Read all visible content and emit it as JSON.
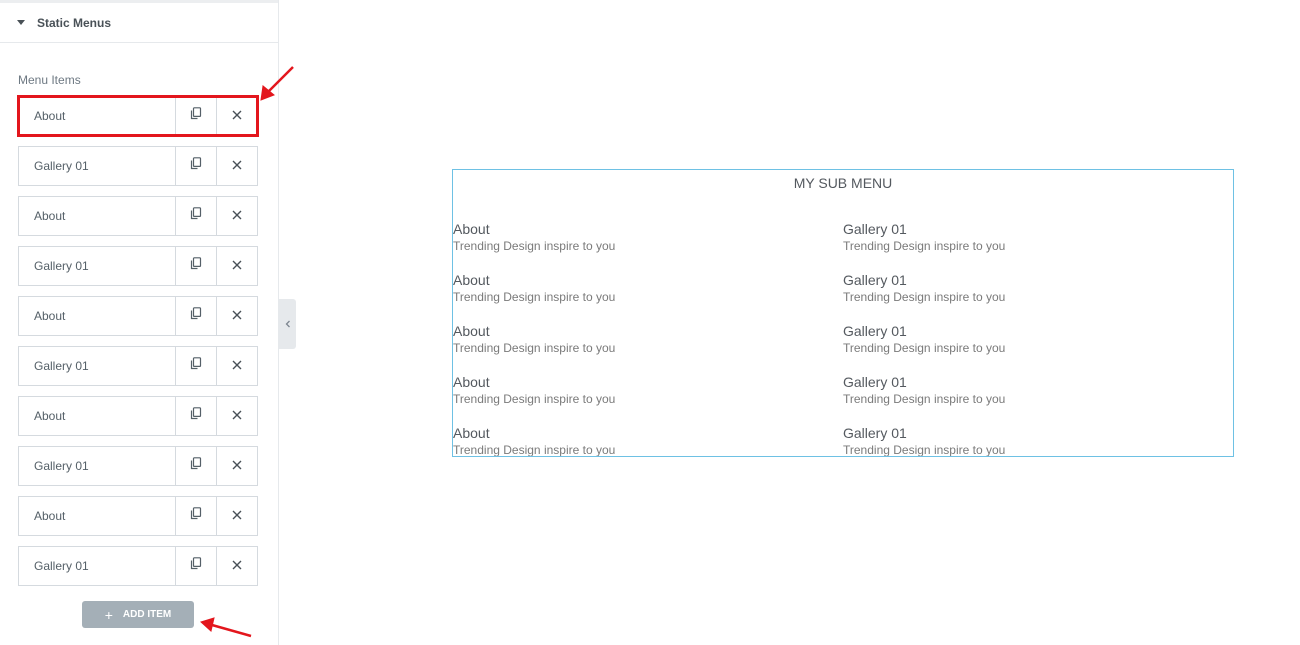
{
  "panel": {
    "section_title": "Static Menus",
    "items_label": "Menu Items",
    "items": [
      {
        "label": "About"
      },
      {
        "label": "Gallery 01"
      },
      {
        "label": "About"
      },
      {
        "label": "Gallery 01"
      },
      {
        "label": "About"
      },
      {
        "label": "Gallery 01"
      },
      {
        "label": "About"
      },
      {
        "label": "Gallery 01"
      },
      {
        "label": "About"
      },
      {
        "label": "Gallery 01"
      }
    ],
    "add_item_label": "ADD ITEM"
  },
  "preview": {
    "title": "MY SUB MENU",
    "rows": [
      [
        {
          "title": "About",
          "desc": "Trending Design inspire to you"
        },
        {
          "title": "Gallery 01",
          "desc": "Trending Design inspire to you"
        }
      ],
      [
        {
          "title": "About",
          "desc": "Trending Design inspire to you"
        },
        {
          "title": "Gallery 01",
          "desc": "Trending Design inspire to you"
        }
      ],
      [
        {
          "title": "About",
          "desc": "Trending Design inspire to you"
        },
        {
          "title": "Gallery 01",
          "desc": "Trending Design inspire to you"
        }
      ],
      [
        {
          "title": "About",
          "desc": "Trending Design inspire to you"
        },
        {
          "title": "Gallery 01",
          "desc": "Trending Design inspire to you"
        }
      ],
      [
        {
          "title": "About",
          "desc": "Trending Design inspire to you"
        },
        {
          "title": "Gallery 01",
          "desc": "Trending Design inspire to you"
        }
      ]
    ]
  },
  "colors": {
    "highlight": "#e3161d",
    "preview_border": "#6ec1e4",
    "add_button": "#a4afb7"
  },
  "icons": {
    "duplicate": "duplicate-icon",
    "remove": "close-icon",
    "collapse": "chevron-left-icon",
    "section_toggle": "caret-down-icon",
    "add": "plus-icon"
  }
}
